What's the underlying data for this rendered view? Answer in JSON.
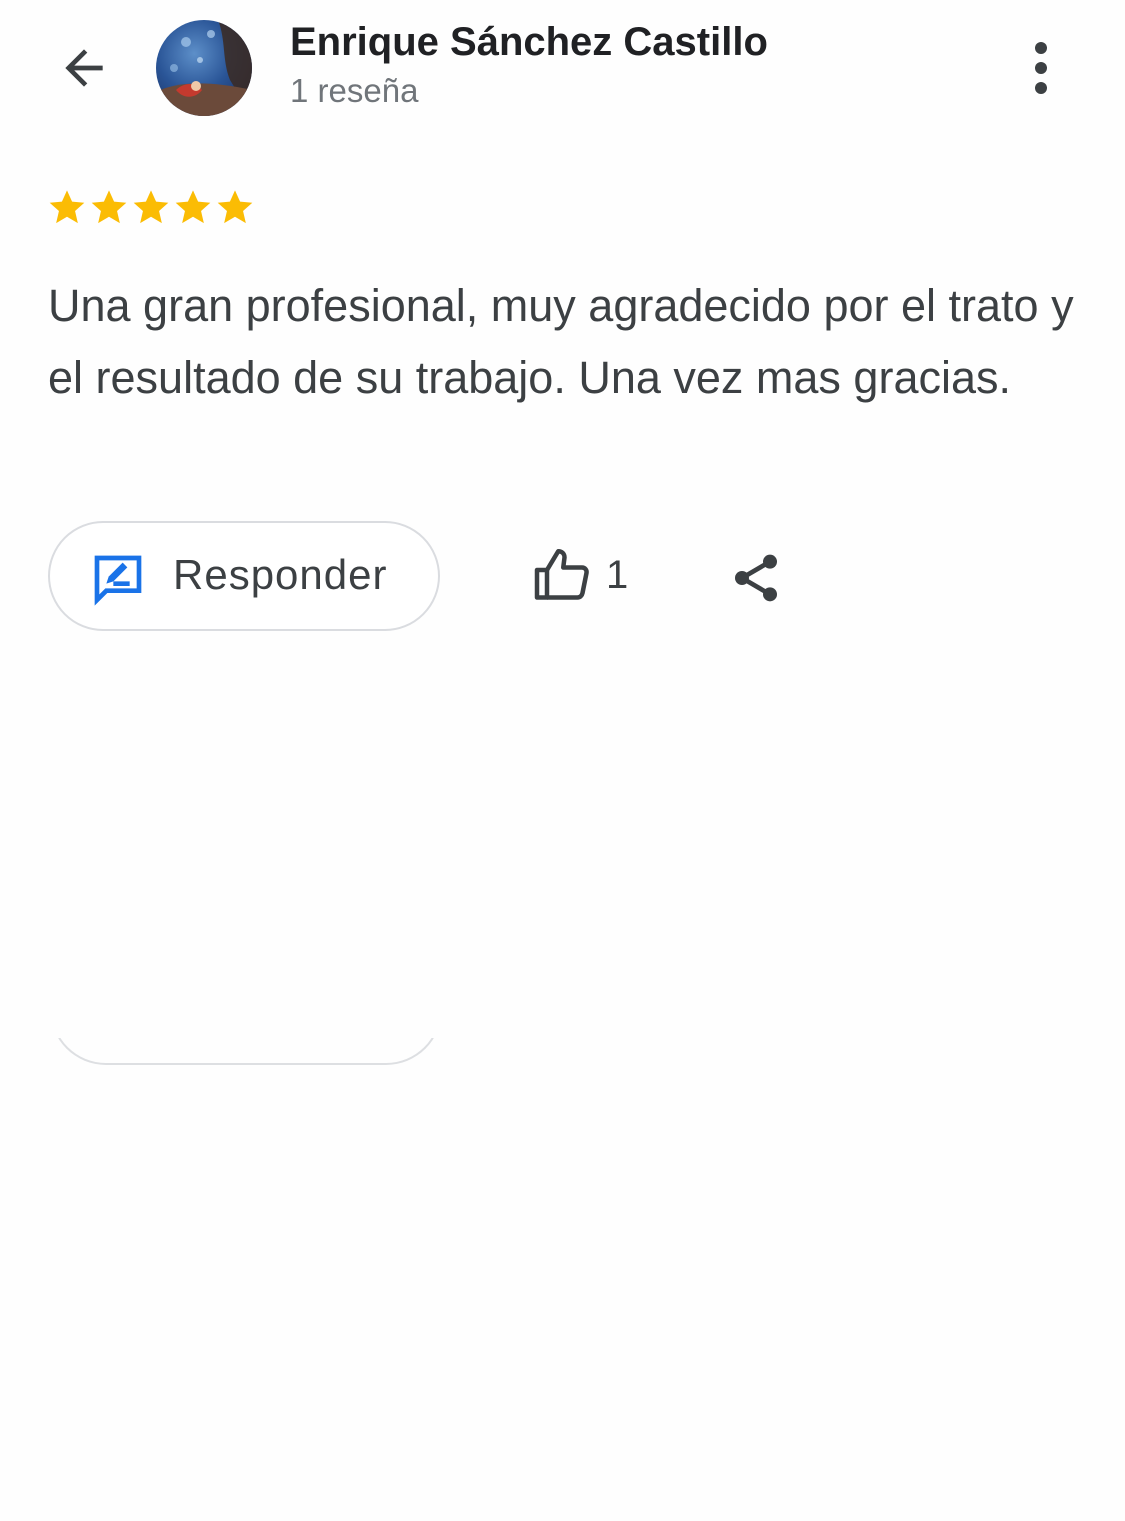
{
  "header": {
    "user_name": "Enrique Sánchez Castillo",
    "review_count": "1 reseña",
    "back_icon": "arrow-back-icon",
    "more_icon": "more-vertical-icon"
  },
  "review": {
    "rating_value": 5,
    "rating_max": 5,
    "star_color": "#fbbc04",
    "text": "Una gran profesional, muy agradecido por el trato y el resultado de su trabajo. Una vez mas gracias."
  },
  "actions": {
    "reply_label": "Responder",
    "reply_icon": "reply-edit-icon",
    "reply_icon_color": "#1a73e8",
    "like_icon": "thumbs-up-icon",
    "like_count": "1",
    "share_icon": "share-icon"
  }
}
